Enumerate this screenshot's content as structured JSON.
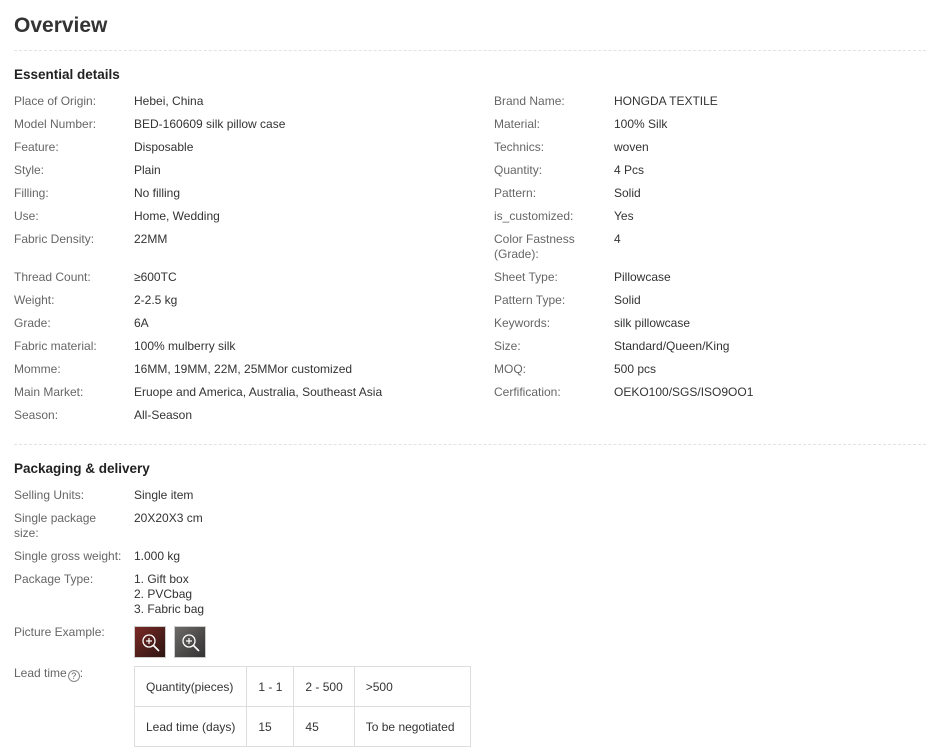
{
  "title": "Overview",
  "essential": {
    "heading": "Essential details",
    "left": [
      {
        "k": "Place of Origin:",
        "v": "Hebei, China"
      },
      {
        "k": "Model Number:",
        "v": "BED-160609 silk pillow case"
      },
      {
        "k": "Feature:",
        "v": "Disposable"
      },
      {
        "k": "Style:",
        "v": "Plain"
      },
      {
        "k": "Filling:",
        "v": "No filling"
      },
      {
        "k": "Use:",
        "v": "Home, Wedding"
      },
      {
        "k": "Fabric Density:",
        "v": "22MM"
      },
      {
        "k": "Thread Count:",
        "v": "≥600TC"
      },
      {
        "k": "Weight:",
        "v": "2-2.5 kg"
      },
      {
        "k": "Grade:",
        "v": "6A"
      },
      {
        "k": "Fabric material:",
        "v": "100% mulberry silk"
      },
      {
        "k": "Momme:",
        "v": "16MM, 19MM, 22M, 25MMor customized"
      },
      {
        "k": "Main Market:",
        "v": "Eruope and America, Australia, Southeast Asia"
      },
      {
        "k": "Season:",
        "v": "All-Season"
      }
    ],
    "right": [
      {
        "k": "Brand Name:",
        "v": "HONGDA TEXTILE"
      },
      {
        "k": "Material:",
        "v": "100% Silk"
      },
      {
        "k": "Technics:",
        "v": "woven"
      },
      {
        "k": "Quantity:",
        "v": "4 Pcs"
      },
      {
        "k": "Pattern:",
        "v": "Solid"
      },
      {
        "k": "is_customized:",
        "v": "Yes"
      },
      {
        "k": "Color Fastness (Grade):",
        "v": "4"
      },
      {
        "k": "Sheet Type:",
        "v": "Pillowcase"
      },
      {
        "k": "Pattern Type:",
        "v": "Solid"
      },
      {
        "k": "Keywords:",
        "v": "silk pillowcase"
      },
      {
        "k": "Size:",
        "v": "Standard/Queen/King"
      },
      {
        "k": "MOQ:",
        "v": "500 pcs"
      },
      {
        "k": "Cerfification:",
        "v": "OEKO100/SGS/ISO9OO1"
      }
    ]
  },
  "packaging": {
    "heading": "Packaging & delivery",
    "selling_units_k": "Selling Units:",
    "selling_units_v": "Single item",
    "package_size_k": "Single package size:",
    "package_size_v": "20X20X3 cm",
    "gross_weight_k": "Single gross weight:",
    "gross_weight_v": "1.000 kg",
    "package_type_k": "Package Type:",
    "package_type_lines": [
      "1. Gift box",
      "2. PVCbag",
      "3. Fabric bag"
    ],
    "picture_k": "Picture Example:",
    "lead_time_k": "Lead time",
    "help_glyph": "?"
  },
  "lead_table": {
    "rows": [
      [
        "Quantity(pieces)",
        "1 - 1",
        "2 - 500",
        ">500"
      ],
      [
        "Lead time (days)",
        "15",
        "45",
        "To be negotiated"
      ]
    ]
  }
}
